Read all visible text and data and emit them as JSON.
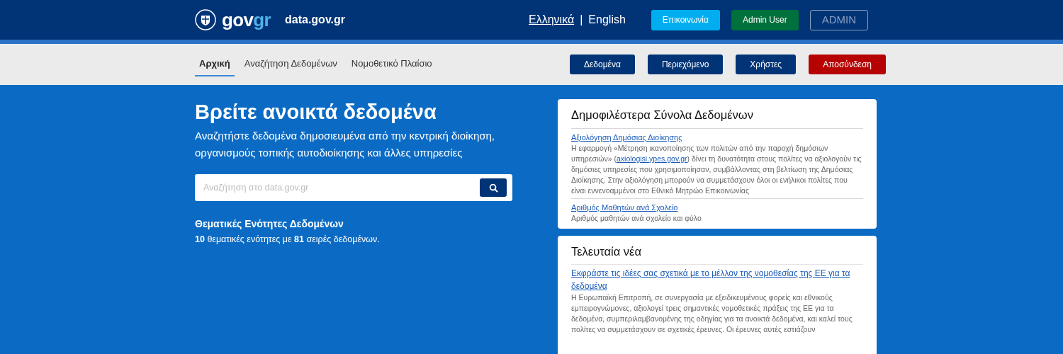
{
  "header": {
    "logo": {
      "part_1": "gov",
      "part_2": "gr"
    },
    "site": "data.gov.gr",
    "language_separator": "|",
    "languages": [
      {
        "label": "Ελληνικά",
        "selected": true
      },
      {
        "label": "English",
        "selected": false
      }
    ],
    "buttons": [
      {
        "label": "Επικοινωνία",
        "kind": "contact"
      },
      {
        "label": "Admin User",
        "kind": "user"
      },
      {
        "label": "ADMIN",
        "kind": "outline"
      }
    ]
  },
  "nav": {
    "tabs": [
      {
        "label": "Αρχική",
        "selected": true
      },
      {
        "label": "Αναζήτηση Δεδομένων",
        "selected": false
      },
      {
        "label": "Νομοθετικό Πλαίσιο",
        "selected": false
      }
    ],
    "buttons": [
      {
        "label": "Δεδομένα",
        "kind": "primary"
      },
      {
        "label": "Περιεχόμενο",
        "kind": "primary"
      },
      {
        "label": "Χρήστες",
        "kind": "primary"
      },
      {
        "label": "Αποσύνδεση",
        "kind": "danger"
      }
    ]
  },
  "hero": {
    "title": "Βρείτε ανοικτά δεδομένα",
    "subtitle": "Αναζητήστε δεδομένα δημοσιευμένα από την κεντρική διοίκηση, οργανισμούς τοπικής αυτοδιοίκησης και άλλες υπηρεσίες",
    "search": {
      "placeholder": "Αναζήτηση στο data.gov.gr"
    },
    "topics_title": "Θεματικές Ενότητες Δεδομένων",
    "topics_text": "**10** θεματικές ενότητες με **81** σειρές δεδομένων."
  },
  "popular": {
    "title": "Δημοφιλέστερα Σύνολα Δεδομένων",
    "items": [
      {
        "title": "Αξιολόγηση Δημόσιας Διοίκησης",
        "description_before": "Η εφαρμογή «Μέτρηση ικανοποίησης των πολιτών από την παροχή δημόσιων υπηρεσιών» (",
        "description_link": "axiologisi.ypes.gov.gr",
        "description_after": ") δίνει τη δυνατότητα στους πολίτες να αξιολογούν τις δημόσιες υπηρεσίες που χρησιμοποίησαν, συμβάλλοντας στη βελτίωση της Δημόσιας Διοίκησης. Στην αξιολόγηση μπορούν να συμμετάσχουν όλοι οι ενήλικοι πολίτες που είναι εννενοαμμένοι στο Εθνικό Μητρώο Επικοινωνίας"
      },
      {
        "title": "Αριθμός Μαθητών ανά Σχολείο",
        "description_before": "Αριθμός μαθητών ανά σχολείο και φύλο"
      }
    ]
  },
  "news": {
    "title": "Τελευταία νέα",
    "items": [
      {
        "title": "Εκφράστε τις ιδέες σας σχετικά με το μέλλον της νομοθεσίας της ΕΕ για τα δεδομένα",
        "description": "Η Ευρωπαϊκή Επιτροπή, σε συνεργασία με εξειδικευμένους φορείς και εθνικούς εμπειρογνώμονες, αξιολογεί τρεις σημαντικές νομοθετικές πράξεις της ΕΕ για τα δεδομένα, συμπεριλαμβανομένης της οδηγίας για τα ανοικτά δεδομένα, και καλεί τους πολίτες να συμμετάσχουν σε σχετικές έρευνες. Οι έρευνες αυτές εστιάζουν"
      }
    ]
  }
}
